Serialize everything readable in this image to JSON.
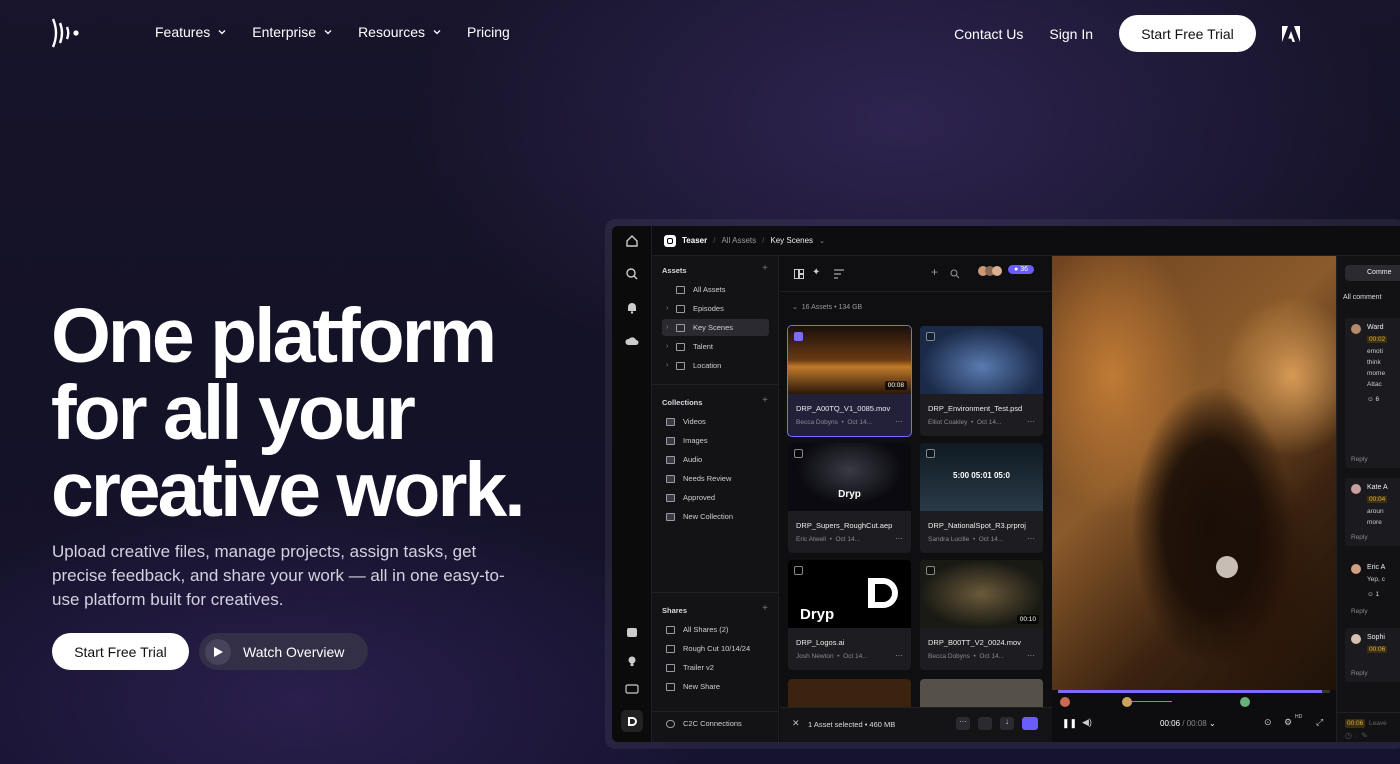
{
  "nav": {
    "links": [
      {
        "label": "Features",
        "dropdown": true
      },
      {
        "label": "Enterprise",
        "dropdown": true
      },
      {
        "label": "Resources",
        "dropdown": true
      },
      {
        "label": "Pricing",
        "dropdown": false
      }
    ],
    "contact": "Contact Us",
    "signin": "Sign In",
    "cta": "Start Free Trial",
    "icons": {
      "logo": "frameio-logo",
      "partner": "adobe-logo"
    }
  },
  "hero": {
    "headline": [
      "One platform",
      "for all your",
      "creative work."
    ],
    "subtitle": "Upload creative files, manage projects, assign tasks, get precise feedback, and share your work — all in one easy-to-use platform built for creatives.",
    "cta_primary": "Start Free Trial",
    "cta_secondary": "Watch Overview"
  },
  "app": {
    "breadcrumb": {
      "project": "Teaser",
      "parent": "All Assets",
      "current": "Key Scenes"
    },
    "sidebar": {
      "assets_title": "Assets",
      "assets": [
        {
          "label": "All Assets",
          "caret": ""
        },
        {
          "label": "Episodes",
          "caret": "›"
        },
        {
          "label": "Key Scenes",
          "caret": "›"
        },
        {
          "label": "Talent",
          "caret": "›"
        },
        {
          "label": "Location",
          "caret": "›"
        }
      ],
      "collections_title": "Collections",
      "collections": [
        "Videos",
        "Images",
        "Audio",
        "Needs Review",
        "Approved",
        "New Collection"
      ],
      "shares_title": "Shares",
      "shares": [
        "All Shares (2)",
        "Rough Cut 10/14/24",
        "Trailer v2",
        "New Share"
      ],
      "connections": "C2C Connections"
    },
    "toolbar": {
      "members_count": "36"
    },
    "summary": {
      "count": "16 Assets",
      "size": "134 GB"
    },
    "tiles": [
      {
        "name": "DRP_A00TQ_V1_0085.mov",
        "author": "Becca Dobyns",
        "date": "Oct 14...",
        "duration": "00:08",
        "selected": true
      },
      {
        "name": "DRP_Environment_Test.psd",
        "author": "Elliot Coakley",
        "date": "Oct 14...",
        "duration": "",
        "selected": false
      },
      {
        "name": "DRP_Supers_RoughCut.aep",
        "author": "Eric Atwell",
        "date": "Oct 14...",
        "duration": "",
        "selected": false,
        "overlay": "Dryp"
      },
      {
        "name": "DRP_NationalSpot_R3.prproj",
        "author": "Sandra Lucille",
        "date": "Oct 14...",
        "duration": "",
        "selected": false,
        "overlay": "5:00   05:01   05:0"
      },
      {
        "name": "DRP_Logos.ai",
        "author": "Josh Newton",
        "date": "Oct 14...",
        "duration": "",
        "selected": false,
        "overlay": "Dryp"
      },
      {
        "name": "DRP_B00TT_V2_0024.mov",
        "author": "Becca Dobyns",
        "date": "Oct 14...",
        "duration": "00:10",
        "selected": false
      }
    ],
    "selection": {
      "text": "1 Asset selected",
      "size": "460 MB"
    },
    "player": {
      "current": "00:06",
      "total": "00:08",
      "quality": "HD",
      "progress": 0.97
    },
    "comments": {
      "tab": "Comme",
      "filter": "All comment",
      "items": [
        {
          "author": "Ward",
          "time": "00:02",
          "lines": [
            "emoti",
            "think",
            "mome",
            "Attac"
          ],
          "reaction": "6",
          "reply": "Reply"
        },
        {
          "author": "Kate A",
          "time": "00:04",
          "lines": [
            "aroun",
            "more"
          ],
          "reply": "Reply"
        },
        {
          "author": "Eric A",
          "time": "",
          "lines": [
            "Yep, c"
          ],
          "reaction": "1",
          "reply": "Reply"
        },
        {
          "author": "Sophi",
          "time": "00:06",
          "lines": [],
          "reply": "Reply"
        }
      ],
      "input_time": "00:06",
      "input_placeholder": "Leave"
    }
  },
  "colors": {
    "accent": "#6a5cff",
    "background": "#16132c"
  }
}
